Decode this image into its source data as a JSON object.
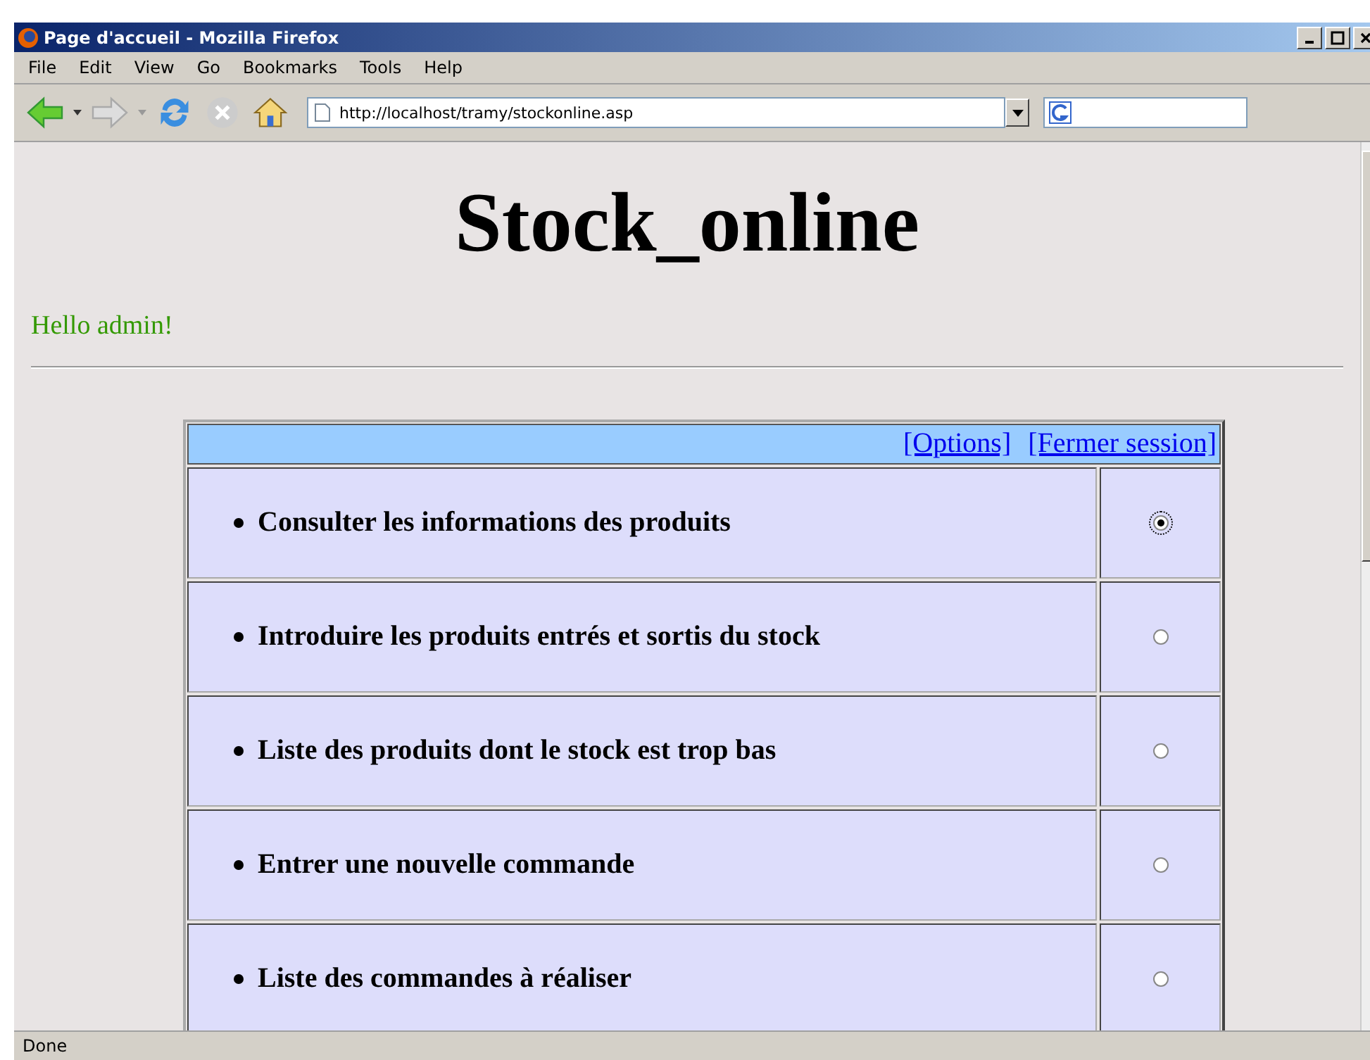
{
  "window": {
    "title": "Page d'accueil - Mozilla Firefox"
  },
  "menu": [
    "File",
    "Edit",
    "View",
    "Go",
    "Bookmarks",
    "Tools",
    "Help"
  ],
  "address": {
    "value": "http://localhost/tramy/stockonline.asp"
  },
  "page": {
    "heading": "Stock_online",
    "greeting": "Hello admin!",
    "links": [
      "[Options]",
      "[Fermer session]"
    ],
    "options": [
      {
        "label": "Consulter les informations des produits",
        "selected": true
      },
      {
        "label": "Introduire les produits entrés et sortis du stock",
        "selected": false
      },
      {
        "label": "Liste des produits dont le stock est trop bas",
        "selected": false
      },
      {
        "label": "Entrer une nouvelle commande",
        "selected": false
      },
      {
        "label": "Liste des commandes à réaliser",
        "selected": false
      }
    ]
  },
  "status_bar": "Done"
}
